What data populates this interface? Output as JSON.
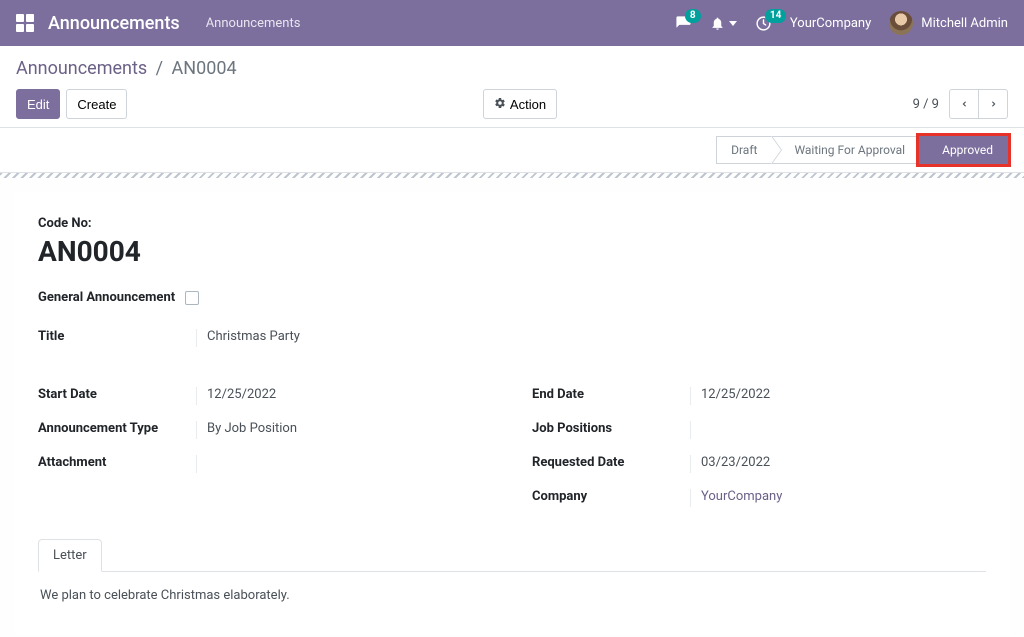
{
  "nav": {
    "brand": "Announcements",
    "menu_item": "Announcements",
    "messages_count": "8",
    "activities_count": "14",
    "company": "YourCompany",
    "user_name": "Mitchell Admin"
  },
  "breadcrumb": {
    "root": "Announcements",
    "current": "AN0004"
  },
  "buttons": {
    "edit": "Edit",
    "create": "Create",
    "action": "Action"
  },
  "pager": {
    "text": "9 / 9"
  },
  "status": {
    "draft": "Draft",
    "waiting": "Waiting For Approval",
    "approved": "Approved"
  },
  "form": {
    "code_label": "Code No:",
    "code_value": "AN0004",
    "general_label": "General Announcement",
    "title_label": "Title",
    "title_value": "Christmas Party",
    "start_date_label": "Start Date",
    "start_date_value": "12/25/2022",
    "end_date_label": "End Date",
    "end_date_value": "12/25/2022",
    "type_label": "Announcement Type",
    "type_value": "By Job Position",
    "positions_label": "Job Positions",
    "positions_value": "",
    "attachment_label": "Attachment",
    "attachment_value": "",
    "requested_label": "Requested Date",
    "requested_value": "03/23/2022",
    "company_label": "Company",
    "company_value": "YourCompany"
  },
  "tabs": {
    "letter": "Letter",
    "letter_body": "We plan to celebrate Christmas elaborately."
  }
}
